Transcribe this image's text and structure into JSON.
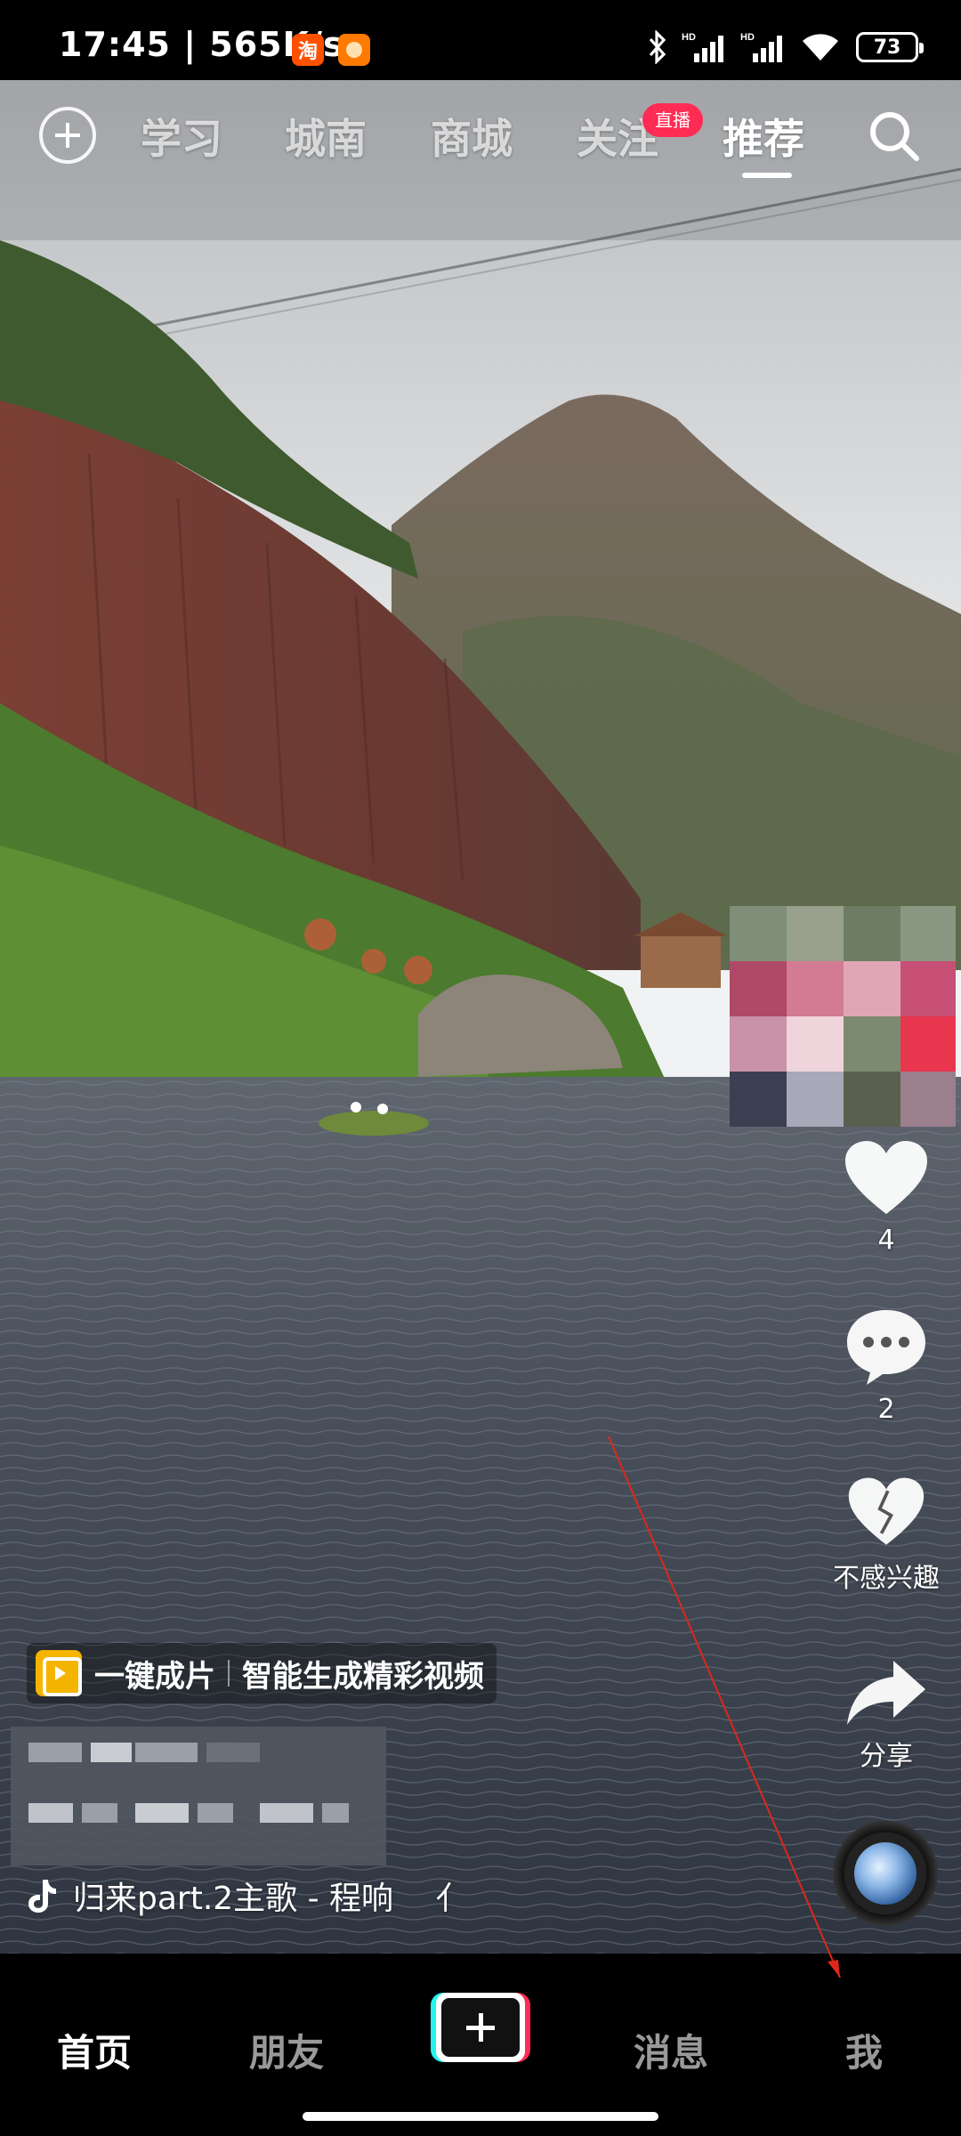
{
  "status_bar": {
    "time_speed": "17:45 | 565K/s",
    "taobao_glyph": "淘",
    "battery": "73",
    "icons": [
      "bluetooth-icon",
      "signal-hd-icon",
      "signal-hd-icon",
      "wifi-icon",
      "battery-icon"
    ]
  },
  "top_nav": {
    "tabs": [
      {
        "label": "学习"
      },
      {
        "label": "城南"
      },
      {
        "label": "商城"
      },
      {
        "label": "关注"
      },
      {
        "label": "推荐"
      }
    ],
    "live_badge": "直播",
    "active_tab": "推荐"
  },
  "actions": {
    "likes": "4",
    "comments": "2",
    "not_interested": "不感兴趣",
    "share": "分享"
  },
  "promo": {
    "label": "一键成片",
    "subtitle": "智能生成精彩视频"
  },
  "music": {
    "text": "归来part.2主歌 - 程响　 亻"
  },
  "bottom_nav": {
    "home": "首页",
    "friends": "朋友",
    "messages": "消息",
    "me": "我"
  },
  "colors": {
    "accent_red": "#fe2c55",
    "accent_cyan": "#25f4ee",
    "promo_yellow": "#f5b400"
  }
}
